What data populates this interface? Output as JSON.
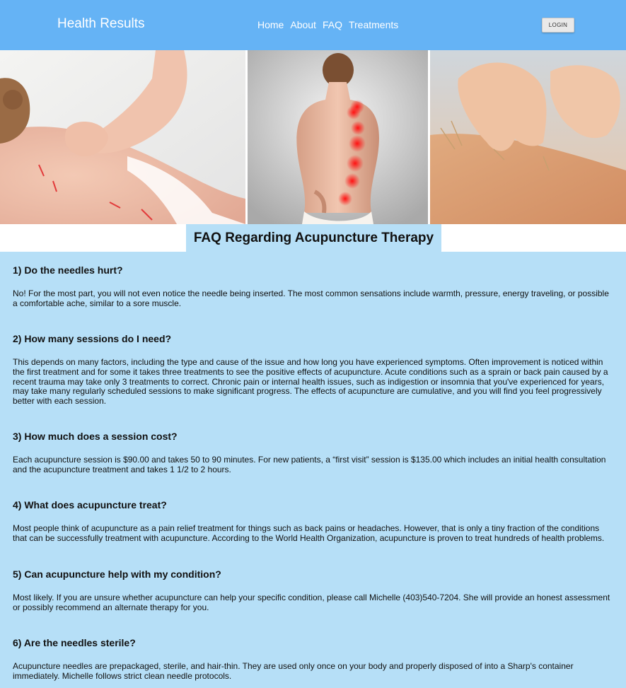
{
  "header": {
    "brand": "Health Results",
    "nav": [
      "Home",
      "About",
      "FAQ",
      "Treatments"
    ],
    "login_label": "LOGIN",
    "color": "#65b3f5"
  },
  "hero": {
    "images": [
      "acupuncture-shoulder-photo",
      "spine-pain-points-photo",
      "acupuncture-hands-photo"
    ]
  },
  "page": {
    "title": "FAQ Regarding Acupuncture Therapy",
    "background": "#b6dff7"
  },
  "faq": [
    {
      "question": "1) Do the needles hurt?",
      "answer": "No! For the most part, you will not even notice the needle being inserted. The most common sensations include warmth, pressure, energy traveling, or possible a comfortable ache, similar to a sore muscle."
    },
    {
      "question": "2) How many sessions do I need?",
      "answer": "This depends on many factors, including the type and cause of the issue and how long you have experienced symptoms. Often improvement is noticed within the first treatment and for some it takes three treatments to see the positive effects of acupuncture. Acute conditions such as a sprain or back pain caused by a recent trauma may take only 3 treatments to correct. Chronic pain or internal health issues, such as indigestion or insomnia that you've experienced for years, may take many regularly scheduled sessions to make significant progress. The effects of acupuncture are cumulative, and you will find you feel progressively better with each session."
    },
    {
      "question": "3) How much does a session cost?",
      "answer": "Each acupuncture session is $90.00 and takes 50 to 90 minutes. For new patients, a “first visit” session is $135.00 which includes an initial health consultation and the acupuncture treatment and takes 1 1/2 to 2 hours."
    },
    {
      "question": "4) What does acupuncture treat?",
      "answer": "Most people think of acupuncture as a pain relief treatment for things such as back pains or headaches. However, that is only a tiny fraction of the conditions that can be successfully treatment with acupuncture. According to the World Health Organization, acupuncture is proven to treat hundreds of health problems."
    },
    {
      "question": "5) Can acupuncture help with my condition?",
      "answer": "Most likely. If you are unsure whether acupuncture can help your specific condition, please call Michelle (403)540-7204. She will provide an honest assessment or possibly recommend an alternate therapy for you."
    },
    {
      "question": "6) Are the needles sterile?",
      "answer": "Acupuncture needles are prepackaged, sterile, and hair-thin. They are used only once on your body and properly disposed of into a Sharp's container immediately. Michelle follows strict clean needle protocols."
    }
  ]
}
